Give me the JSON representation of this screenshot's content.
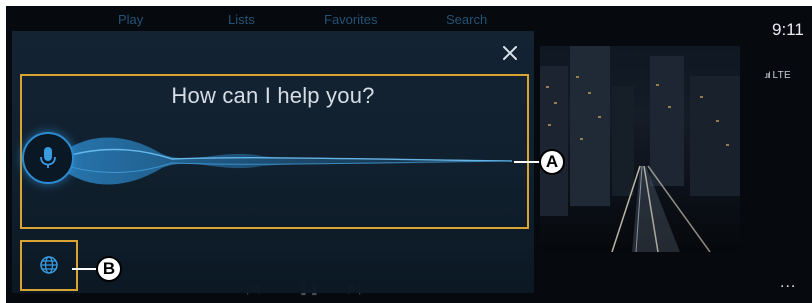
{
  "screen": {
    "background_tabs": [
      "Play",
      "Lists",
      "Favorites",
      "Search"
    ],
    "status": {
      "time": "9:11",
      "network": "LTE"
    },
    "more_menu_label": "..."
  },
  "voice_assistant": {
    "prompt": "How can I help you?",
    "icons": {
      "close": "close-icon",
      "microphone": "microphone-icon",
      "language": "globe-icon"
    },
    "accent_color": "#2d8bd0"
  },
  "annotations": {
    "callout_a": "A",
    "callout_b": "B",
    "highlight_color": "#d9a431"
  }
}
